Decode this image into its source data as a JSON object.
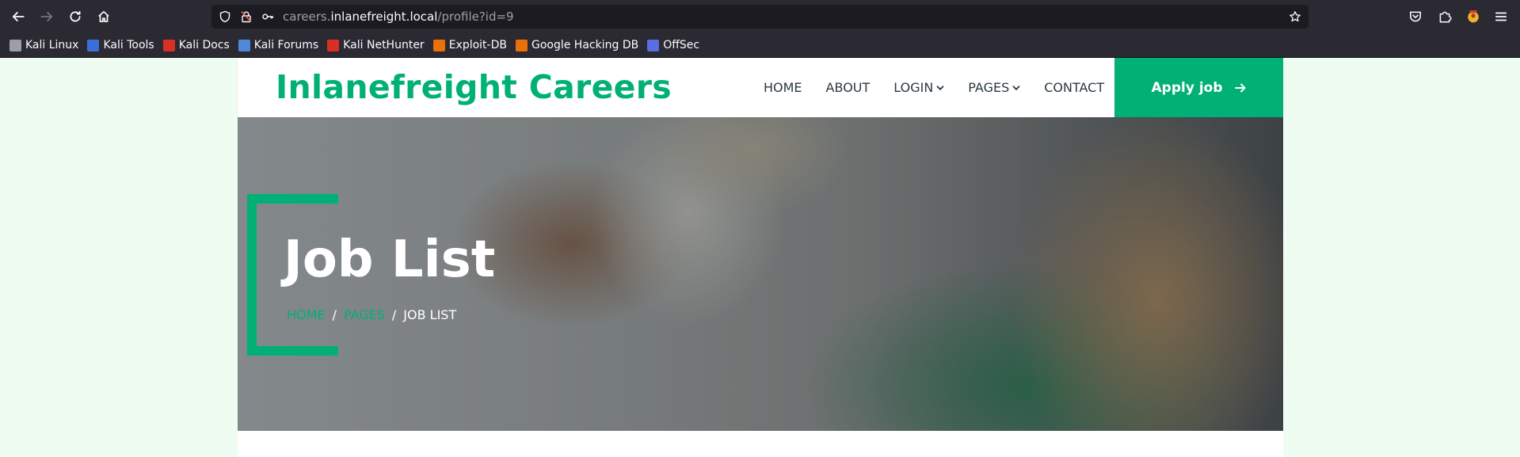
{
  "browser": {
    "url_host_prefix": "careers.",
    "url_host_main": "inlanefreight.local",
    "url_path": "/profile?id=9"
  },
  "bookmarks": [
    {
      "label": "Kali Linux",
      "color": "#9aa0a6"
    },
    {
      "label": "Kali Tools",
      "color": "#3d6fd8"
    },
    {
      "label": "Kali Docs",
      "color": "#d93025"
    },
    {
      "label": "Kali Forums",
      "color": "#4e8ad6"
    },
    {
      "label": "Kali NetHunter",
      "color": "#d93025"
    },
    {
      "label": "Exploit-DB",
      "color": "#e8710a"
    },
    {
      "label": "Google Hacking DB",
      "color": "#e8710a"
    },
    {
      "label": "OffSec",
      "color": "#5b6ee1"
    }
  ],
  "site": {
    "brand": "Inlanefreight Careers",
    "accent_color": "#00b074",
    "menu": [
      {
        "label": "HOME",
        "dropdown": false
      },
      {
        "label": "ABOUT",
        "dropdown": false
      },
      {
        "label": "LOGIN",
        "dropdown": true
      },
      {
        "label": "PAGES",
        "dropdown": true
      },
      {
        "label": "CONTACT",
        "dropdown": false
      }
    ],
    "apply_label": "Apply job"
  },
  "hero": {
    "title": "Job List",
    "breadcrumb": {
      "home": "HOME",
      "pages": "PAGES",
      "current": "JOB LIST",
      "separator": "/"
    }
  }
}
